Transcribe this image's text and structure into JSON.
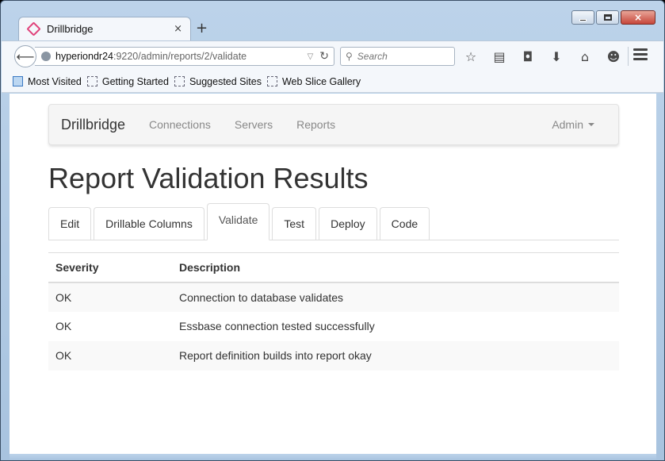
{
  "browser": {
    "tab": {
      "title": "Drillbridge",
      "close_glyph": "×"
    },
    "new_tab_glyph": "+",
    "window_controls": {
      "close_glyph": "×"
    },
    "address": {
      "host": "hyperiondr24",
      "rest": ":9220/admin/reports/2/validate"
    },
    "search": {
      "placeholder": "Search"
    },
    "toolbar_icons": [
      "star-icon",
      "reading-list-icon",
      "pocket-icon",
      "download-icon",
      "home-icon",
      "chat-icon"
    ],
    "bookmarks": [
      "Most Visited",
      "Getting Started",
      "Suggested Sites",
      "Web Slice Gallery"
    ]
  },
  "app": {
    "navbar": {
      "brand": "Drillbridge",
      "links": [
        "Connections",
        "Servers",
        "Reports"
      ],
      "user_menu": "Admin"
    },
    "page_title": "Report Validation Results",
    "tabs": [
      {
        "label": "Edit",
        "active": false
      },
      {
        "label": "Drillable Columns",
        "active": false
      },
      {
        "label": "Validate",
        "active": true
      },
      {
        "label": "Test",
        "active": false
      },
      {
        "label": "Deploy",
        "active": false
      },
      {
        "label": "Code",
        "active": false
      }
    ],
    "table": {
      "headers": [
        "Severity",
        "Description"
      ],
      "rows": [
        [
          "OK",
          "Connection to database validates"
        ],
        [
          "OK",
          "Essbase connection tested successfully"
        ],
        [
          "OK",
          "Report definition builds into report okay"
        ]
      ]
    }
  },
  "colors": {
    "accent_favicon": "#e0417a",
    "chrome": "#bcd3ea"
  }
}
